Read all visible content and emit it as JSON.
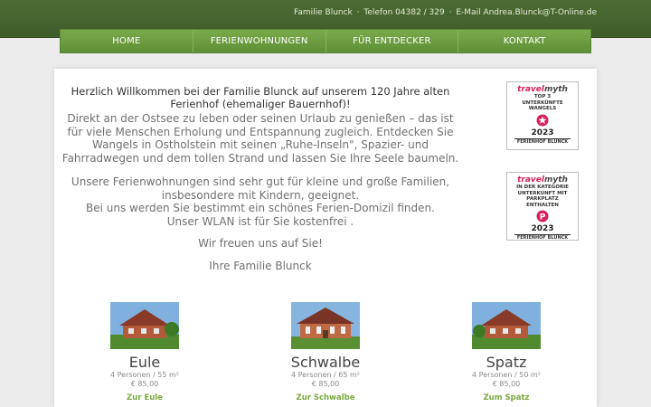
{
  "header": {
    "contact_name": "Familie Blunck",
    "separator": "·",
    "phone": "Telefon 04382 / 329",
    "email": "E-Mail Andrea.Blunck@T-Online.de"
  },
  "nav": {
    "items": [
      {
        "label": "HOME"
      },
      {
        "label": "FERIENWOHNUNGEN"
      },
      {
        "label": "FÜR ENTDECKER"
      },
      {
        "label": "KONTAKT"
      }
    ]
  },
  "intro": {
    "heading": "Herzlich Willkommen bei der Familie Blunck auf unserem 120 Jahre alten Ferienhof (ehemaliger Bauernhof)!",
    "paragraph1": "Direkt an der Ostsee zu leben oder seinen Urlaub zu genießen – das ist für viele Menschen Erholung und Entspannung zugleich. Entdecken Sie Wangels in Ostholstein mit seinen „Ruhe-Inseln\", Spazier- und Fahrradwegen und dem tollen Strand und lassen Sie Ihre Seele baumeln.",
    "paragraph2_line1": "Unsere Ferienwohnungen sind sehr gut für kleine und große Familien, insbesondere mit Kindern, geeignet.",
    "paragraph2_line2": "Bei uns werden Sie bestimmt ein schönes Ferien-Domizil finden.",
    "paragraph2_line3": "Unser WLAN ist für Sie kostenfrei .",
    "closing": "Wir freuen uns auf Sie!",
    "signature": "Ihre Familie Blunck"
  },
  "badges": [
    {
      "brand_left": "travel",
      "brand_right": "myth",
      "line1": "TOP 3",
      "line2": "UNTERKÜNFTE",
      "line3": "WANGELS",
      "year": "2023",
      "farm": "FERIENHOF BLUNCK",
      "mark_color": "#d6215a"
    },
    {
      "brand_left": "travel",
      "brand_right": "myth",
      "line1": "IN DER KATEGORIE",
      "line2": "UNTERKUNFT MIT PARKPLATZ",
      "line3": "ENTHALTEN",
      "year": "2023",
      "farm": "FERIENHOF BLUNCK",
      "mark_color": "#d6215a"
    }
  ],
  "apartments": [
    {
      "name": "Eule",
      "info": "4 Personen  / 55 m²",
      "price": "€ 85,00",
      "link": "Zur Eule"
    },
    {
      "name": "Schwalbe",
      "info": "4 Personen  / 65 m²",
      "price": "€ 85,00",
      "link": "Zur Schwalbe"
    },
    {
      "name": "Spatz",
      "info": "4 Personen  / 50 m²",
      "price": "€ 85,00",
      "link": "Zum Spatz"
    }
  ],
  "colors": {
    "header_green": "#4c6d33",
    "nav_green": "#6a9a3e",
    "link_green": "#7aa93f",
    "badge_accent": "#d6215a"
  }
}
